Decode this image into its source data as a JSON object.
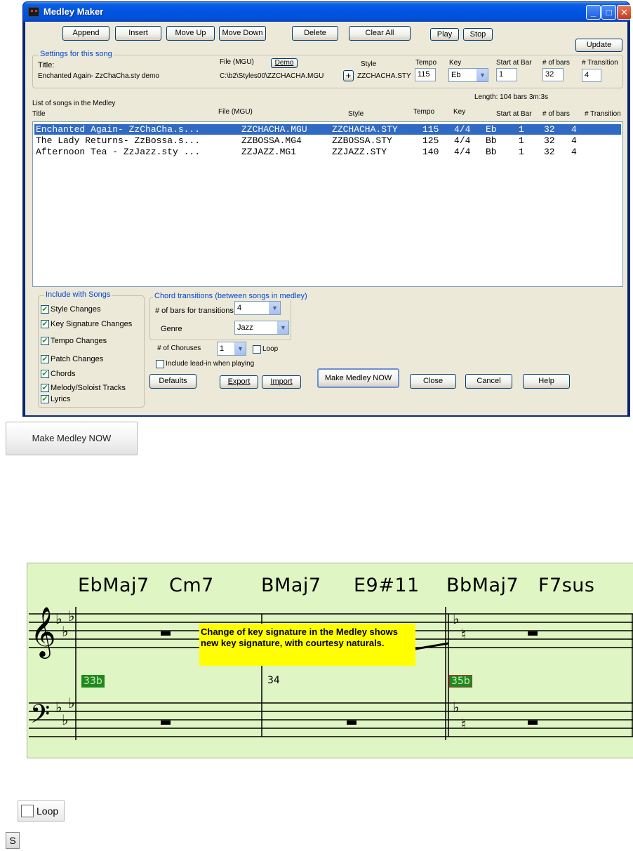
{
  "window": {
    "title": "Medley Maker",
    "controls": {
      "minimize": "_",
      "maximize": "□",
      "close": "✕"
    }
  },
  "toolbar": {
    "append": "Append",
    "insert": "Insert",
    "move_up": "Move Up",
    "move_down": "Move Down",
    "delete": "Delete",
    "clear_all": "Clear All",
    "play": "Play",
    "stop": "Stop",
    "update": "Update"
  },
  "settings": {
    "group_title": "Settings for this song",
    "title_label": "Title:",
    "title_value": "Enchanted Again- ZzChaCha.sty demo",
    "file_label": "File (MGU)",
    "demo_button": "Demo",
    "file_value": "C:\\b2\\Styles00\\ZZCHACHA.MGU",
    "plus_button": "+",
    "style_label": "Style",
    "style_value": "ZZCHACHA.STY",
    "tempo_label": "Tempo",
    "tempo_value": "115",
    "key_label": "Key",
    "key_value": "Eb",
    "start_label": "Start at Bar",
    "start_value": "1",
    "bars_label": "# of bars",
    "bars_value": "32",
    "transition_label": "# Transition",
    "transition_value": "4"
  },
  "list": {
    "length_text": "Length:  104 bars  3m:3s",
    "caption": "List of songs in the Medley",
    "columns": {
      "title": "Title",
      "file": "File (MGU)",
      "style": "Style",
      "tempo": "Tempo",
      "key": "Key",
      "start": "Start at Bar",
      "bars": "# of bars",
      "transition": "# Transition"
    },
    "rows": [
      {
        "title": "Enchanted Again- ZzChaCha.s...",
        "file": "ZZCHACHA.MGU",
        "style": "ZZCHACHA.STY",
        "tempo": "115",
        "meter": "4/4",
        "key": "Eb",
        "start": "1",
        "bars": "32",
        "transition": "4"
      },
      {
        "title": "The Lady Returns- ZzBossa.s...",
        "file": "ZZBOSSA.MG4",
        "style": "ZZBOSSA.STY",
        "tempo": "125",
        "meter": "4/4",
        "key": "Bb",
        "start": "1",
        "bars": "32",
        "transition": "4"
      },
      {
        "title": "Afternoon Tea - ZzJazz.sty ...",
        "file": "ZZJAZZ.MG1",
        "style": "ZZJAZZ.STY",
        "tempo": "140",
        "meter": "4/4",
        "key": "Bb",
        "start": "1",
        "bars": "32",
        "transition": "4"
      }
    ]
  },
  "include": {
    "group_title": "Include with Songs",
    "items": [
      {
        "label": "Style Changes",
        "checked": true
      },
      {
        "label": "Key Signature Changes",
        "checked": true
      },
      {
        "label": "Tempo Changes",
        "checked": true
      },
      {
        "label": "Patch Changes",
        "checked": true
      },
      {
        "label": "Chords",
        "checked": true
      },
      {
        "label": "Melody/Soloist Tracks",
        "checked": true
      },
      {
        "label": "Lyrics",
        "checked": true
      }
    ]
  },
  "transitions": {
    "group_title": "Chord transitions (between songs in medley)",
    "bars_label": "# of bars for transitions",
    "bars_value": "4",
    "genre_label": "Genre",
    "genre_value": "Jazz"
  },
  "choruses": {
    "label": "# of Choruses",
    "value": "1",
    "loop_label": "Loop",
    "leadin_label": "Include lead-in when playing"
  },
  "bottom": {
    "defaults": "Defaults",
    "export": "Export",
    "import": "Import",
    "make_medley": "Make Medley NOW",
    "close": "Close",
    "cancel": "Cancel",
    "help": "Help"
  },
  "zoom": {
    "make_medley": "Make Medley NOW",
    "loop": "Loop",
    "s_key": "S"
  },
  "notation": {
    "chords": [
      "EbMaj7",
      "Cm7",
      "BMaj7",
      "E9#11",
      "BbMaj7",
      "F7sus"
    ],
    "callout": "Change of key signature in the Medley shows new key signature, with courtesy naturals.",
    "bars": [
      "33b",
      "34",
      "35b"
    ]
  }
}
